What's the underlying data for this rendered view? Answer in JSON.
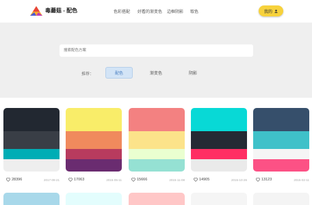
{
  "header": {
    "brand": "毒蘑菇 - 配色",
    "nav": [
      "色彩搭配",
      "好看的渐变色",
      "边框阴影",
      "取色"
    ],
    "my_button": "我的"
  },
  "search": {
    "placeholder": "搜索配色方案"
  },
  "filters": {
    "label": "推荐：",
    "items": [
      "配色",
      "渐变色",
      "阴影"
    ],
    "active": "配色"
  },
  "cards": [
    {
      "colors": [
        "#222831",
        "#393e46",
        "#00adb5",
        "#eeeeee"
      ],
      "likes": "28396",
      "date": "2017-09-21"
    },
    {
      "colors": [
        "#f9ed69",
        "#f08a5d",
        "#b83b5e",
        "#6a2c70"
      ],
      "likes": "17063",
      "date": "2015-05-11"
    },
    {
      "colors": [
        "#f38181",
        "#fce38a",
        "#eaffd0",
        "#95e1d3"
      ],
      "likes": "15666",
      "date": "2015-11-08"
    },
    {
      "colors": [
        "#08d9d6",
        "#252a34",
        "#ff2e63",
        "#eaeaea"
      ],
      "likes": "14905",
      "date": "2015-10-26"
    },
    {
      "colors": [
        "#364f6b",
        "#3fc1c9",
        "#f5f5f5",
        "#fc5185"
      ],
      "likes": "13123",
      "date": "2015-02-11"
    }
  ],
  "next_row_top_colors": [
    "#a8d8ea",
    "#e3fdfd",
    "#ffc7c7",
    "#f5f5f5",
    "#f4f4f4"
  ]
}
